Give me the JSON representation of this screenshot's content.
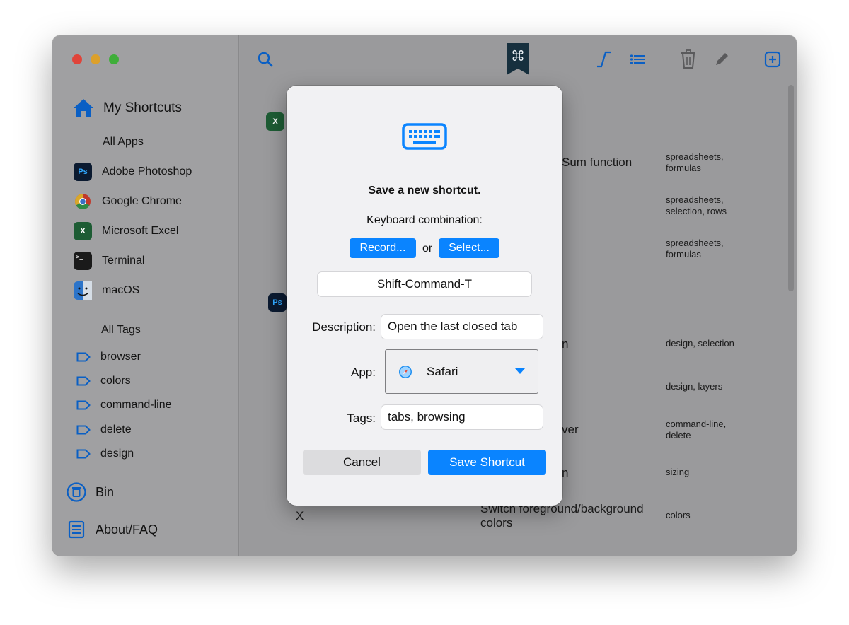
{
  "sidebar": {
    "home_label": "My Shortcuts",
    "all_apps": "All Apps",
    "apps": [
      {
        "label": "Adobe Photoshop",
        "icon": "photoshop-icon",
        "glyph": "Ps"
      },
      {
        "label": "Google Chrome",
        "icon": "chrome-icon",
        "glyph": ""
      },
      {
        "label": "Microsoft Excel",
        "icon": "excel-icon",
        "glyph": "X"
      },
      {
        "label": "Terminal",
        "icon": "terminal-icon",
        "glyph": ">_"
      },
      {
        "label": "macOS",
        "icon": "finder-icon",
        "glyph": ""
      }
    ],
    "all_tags": "All Tags",
    "tags": [
      "browser",
      "colors",
      "command-line",
      "delete",
      "design"
    ],
    "bin_label": "Bin",
    "about_label": "About/FAQ"
  },
  "toolbar": {
    "logo_glyph": "⌘"
  },
  "background_rows": [
    {
      "text": "Sum function",
      "tags": [
        "spreadsheets,",
        "formulas"
      ]
    },
    {
      "text": "",
      "tags": [
        "spreadsheets,",
        "selection, rows"
      ]
    },
    {
      "text": "",
      "tags": [
        "spreadsheets,",
        "formulas"
      ]
    },
    {
      "text": "n",
      "tags": [
        "design, selection"
      ]
    },
    {
      "text": "",
      "tags": [
        "design, layers"
      ]
    },
    {
      "text": "ver",
      "tags": [
        "command-line,",
        "delete"
      ]
    },
    {
      "text": "n",
      "tags": [
        "sizing"
      ]
    },
    {
      "key": "X",
      "text_lines": [
        "Switch foreground/background",
        "colors"
      ],
      "tags": [
        "colors"
      ]
    }
  ],
  "dialog": {
    "title": "Save a new shortcut.",
    "combo_label": "Keyboard combination:",
    "record_button": "Record...",
    "or_text": "or",
    "select_button": "Select...",
    "combination_value": "Shift-Command-T",
    "description_label": "Description:",
    "description_value": "Open the last closed tab",
    "app_label": "App:",
    "app_value": "Safari",
    "tags_label": "Tags:",
    "tags_value": "tabs, browsing",
    "cancel_button": "Cancel",
    "save_button": "Save Shortcut"
  },
  "colors": {
    "accent": "#0a84ff",
    "ps_blue": "#001e36",
    "excel_green": "#1d6f42"
  }
}
